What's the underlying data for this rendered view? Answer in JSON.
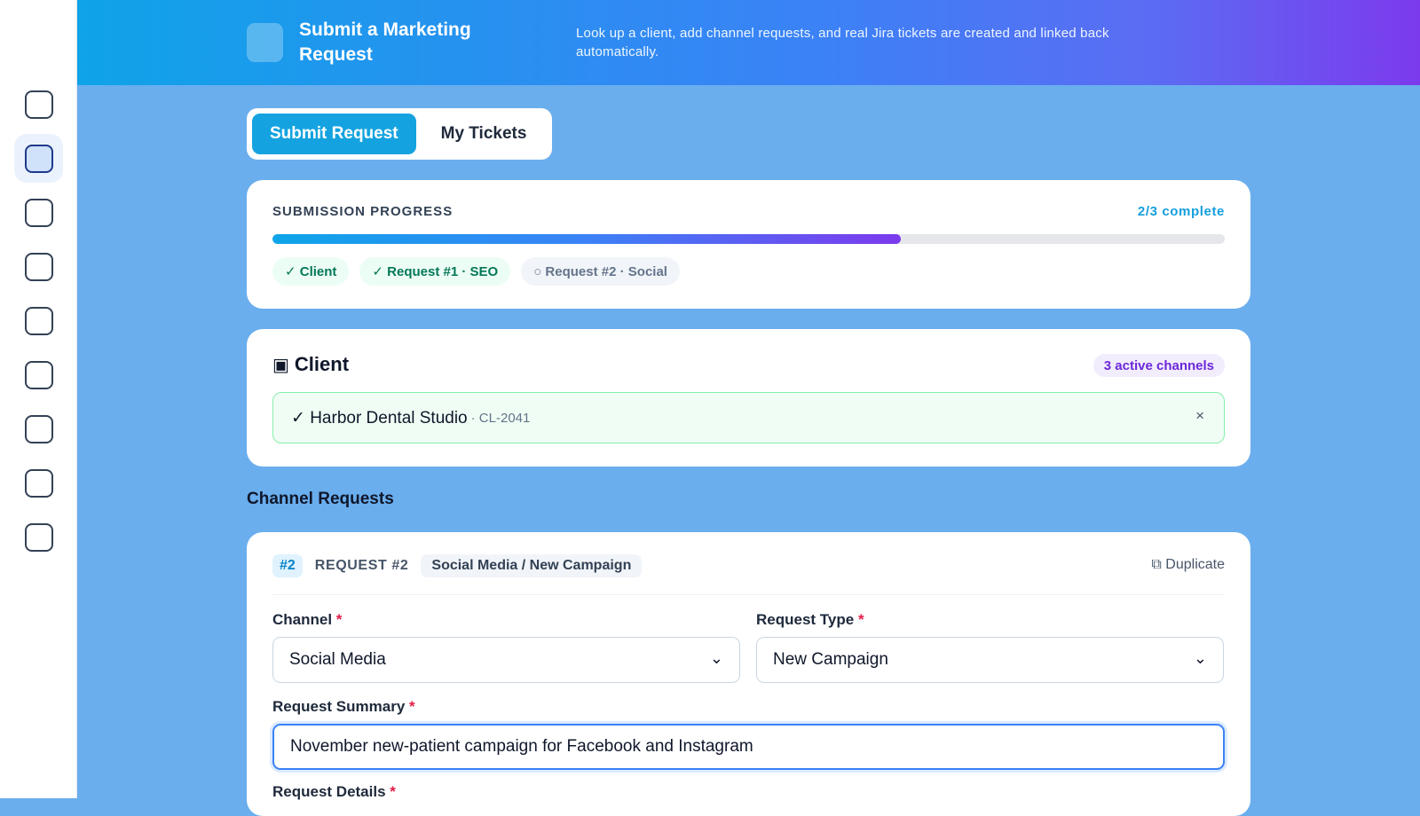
{
  "app": {
    "title": "Submit a Marketing Request",
    "description": "Look up a client, add channel requests, and real Jira tickets are created and linked back automatically."
  },
  "tabs": [
    {
      "label": "Submit Request",
      "active": true
    },
    {
      "label": "My Tickets",
      "active": false
    }
  ],
  "progress": {
    "label": "SUBMISSION PROGRESS",
    "count_text": "2/3 complete",
    "fraction": 0.66,
    "steps": [
      {
        "label": "✓ Client",
        "done": true
      },
      {
        "label": "✓ Request #1 · SEO",
        "done": true
      },
      {
        "label": "○ Request #2 · Social",
        "done": false
      }
    ]
  },
  "client": {
    "title": "Client",
    "icon": "square-icon",
    "channels_badge": "3 active channels",
    "selected_name": "✓ Harbor Dental Studio",
    "selected_id": "· CL-2041",
    "clear_symbol": "×"
  },
  "channel_requests": {
    "section_title": "Channel Requests",
    "request": {
      "number": "#2",
      "label": "REQUEST #2",
      "tag": "Social Media / New Campaign",
      "duplicate": "⧉ Duplicate",
      "channel_label": "Channel",
      "channel_value": "Social Media",
      "type_label": "Request Type",
      "type_value": "New Campaign",
      "summary_label": "Request Summary",
      "summary_value": "November new-patient campaign for Facebook and Instagram",
      "details_label": "Request Details",
      "required_mark": "*",
      "chevron": "⌄"
    }
  },
  "colors": {
    "accent": "#14a3e0",
    "background": "#6aaeee",
    "success": "#047857",
    "purple": "#6d28d9"
  }
}
